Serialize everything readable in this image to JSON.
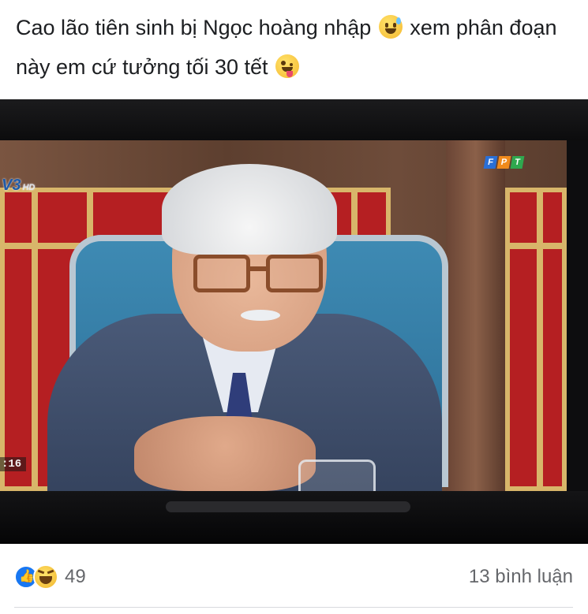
{
  "post": {
    "caption_part1": "Cao lão tiên sinh bị Ngọc hoàng nhập",
    "caption_emoji1": "sweat-smile-emoji",
    "caption_part2": "xem phân đoạn này em cứ tưởng tối 30 tết",
    "caption_emoji2": "zany-face-emoji"
  },
  "image": {
    "channel_logo": "V3",
    "channel_hd": "HD",
    "provider_logo_letters": [
      "F",
      "P",
      "T"
    ],
    "provider_colors": [
      "#2a6fd6",
      "#f08a1c",
      "#2fa84f"
    ],
    "time_badge": ":16"
  },
  "reactions": {
    "icons": [
      "like-icon",
      "haha-icon"
    ],
    "count": "49",
    "comments": "13 bình luận"
  }
}
